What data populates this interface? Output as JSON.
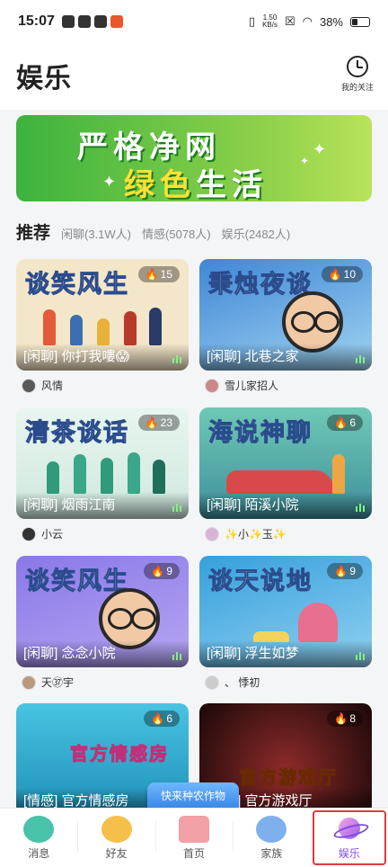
{
  "status": {
    "time": "15:07",
    "net_speed_top": "1.50",
    "net_speed_bottom": "KB/s",
    "battery": "38%"
  },
  "header": {
    "title": "娱乐",
    "follow_label": "我的关注"
  },
  "banner": {
    "line1": "严格净网",
    "line2_a": "绿色",
    "line2_b": "生活"
  },
  "tabs": {
    "main": "推荐",
    "items": [
      "闲聊(3.1W人)",
      "情感(5078人)",
      "娱乐(2482人)"
    ]
  },
  "cards": [
    {
      "title": "谈笑风生",
      "heat": "15",
      "caption": "[闲聊] 你打我嘍😱",
      "host": "风情",
      "bg": "#f4e7c9"
    },
    {
      "title": "秉烛夜谈",
      "heat": "10",
      "caption": "[闲聊] 北巷之家",
      "host": "雪儿家招人",
      "bg": "#3f86d6"
    },
    {
      "title": "清茶谈话",
      "heat": "23",
      "caption": "[闲聊] 烟雨江南",
      "host": "小云",
      "bg": "#dff1ea"
    },
    {
      "title": "海说神聊",
      "heat": "6",
      "caption": "[闲聊] 陌溪小院",
      "host": "✨小✨玉✨",
      "bg": "#5fb9a8"
    },
    {
      "title": "谈笑风生",
      "heat": "9",
      "caption": "[闲聊] 念念小院",
      "host": "天㊲宇",
      "bg": "#8a78e8"
    },
    {
      "title": "谈天说地",
      "heat": "9",
      "caption": "[闲聊] 浮生如梦",
      "host": "、 悸初",
      "bg": "#36a0dc"
    },
    {
      "title": "官方情感房",
      "heat": "6",
      "caption": "[情感] 官方情感房",
      "host": "",
      "bg": "#35b7d8"
    },
    {
      "title": "官方游戏厅",
      "heat": "8",
      "caption": "[娱乐] 官方游戏厅",
      "host": "",
      "bg": "#7a1b1b"
    }
  ],
  "float_button": "快来种农作物",
  "nav": [
    {
      "label": "消息"
    },
    {
      "label": "好友"
    },
    {
      "label": "首页"
    },
    {
      "label": "家族"
    },
    {
      "label": "娱乐"
    }
  ],
  "colors": {
    "accent": "#e23b3b",
    "banner_green": "#3cb33f",
    "float_blue": "#2f7fe0"
  }
}
